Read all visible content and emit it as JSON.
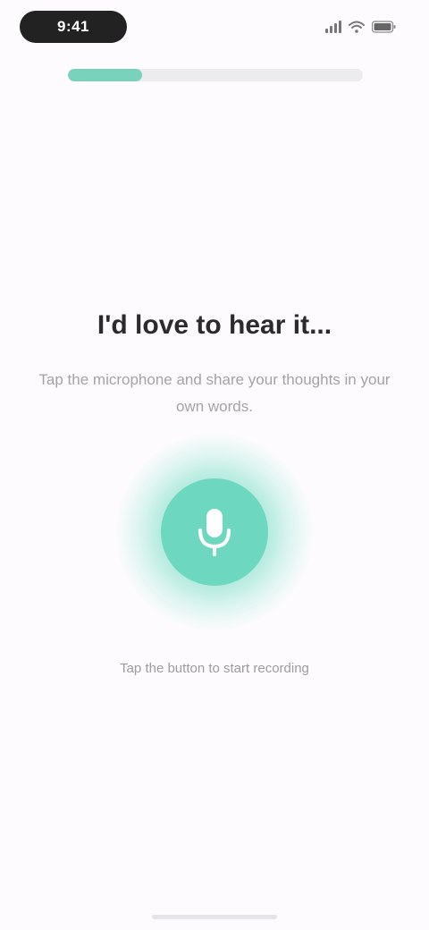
{
  "status_bar": {
    "time": "9:41",
    "signal_icon": "signal-icon",
    "wifi_icon": "wifi-icon",
    "battery_icon": "battery-icon"
  },
  "progress": {
    "value": 0.25,
    "color": "#79d3bc"
  },
  "prompt": {
    "heading": "I'd love to hear it...",
    "subtext": "Tap the microphone and share your thoughts in your own words."
  },
  "mic": {
    "icon": "microphone-icon",
    "color": "#6ed7bf"
  },
  "hint": {
    "text": "Tap the button to start recording"
  }
}
